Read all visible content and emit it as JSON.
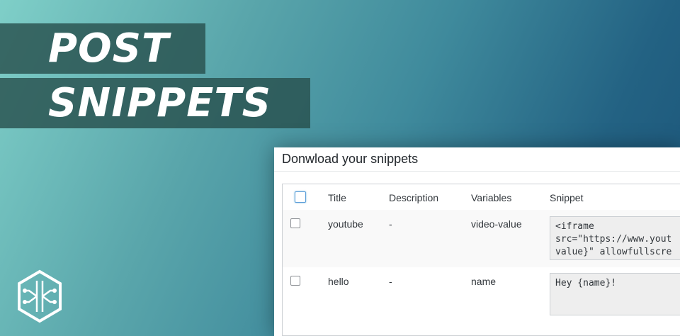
{
  "banner": {
    "title_line1": "POST",
    "title_line2": "SNIPPETS"
  },
  "logo": {
    "icon": "hexagon-circuit-logo"
  },
  "panel": {
    "heading": "Donwload your snippets",
    "columns": [
      "Title",
      "Description",
      "Variables",
      "Snippet"
    ],
    "rows": [
      {
        "title": "youtube",
        "description": "-",
        "variables": "video-value",
        "snippet": "<iframe\nsrc=\"https://www.yout\nvalue}\" allowfullscre"
      },
      {
        "title": "hello",
        "description": "-",
        "variables": "name",
        "snippet": "Hey {name}!"
      }
    ]
  },
  "colors": {
    "banner_bg": "#285050",
    "gradient_start": "#7fcfc8",
    "gradient_end": "#1b5478",
    "checkbox_focus": "#5b9dd9"
  }
}
